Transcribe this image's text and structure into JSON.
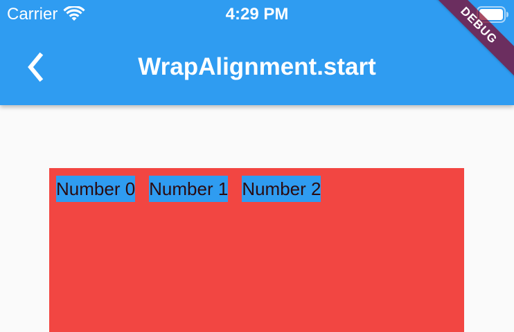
{
  "status_bar": {
    "carrier": "Carrier",
    "time": "4:29 PM"
  },
  "app_bar": {
    "title": "WrapAlignment.start",
    "color": "#2f9cf1"
  },
  "debug_banner": {
    "label": "DEBUG"
  },
  "wrap": {
    "background": "#f24642",
    "items": [
      {
        "label": "Number 0"
      },
      {
        "label": "Number 1"
      },
      {
        "label": "Number 2"
      }
    ]
  }
}
